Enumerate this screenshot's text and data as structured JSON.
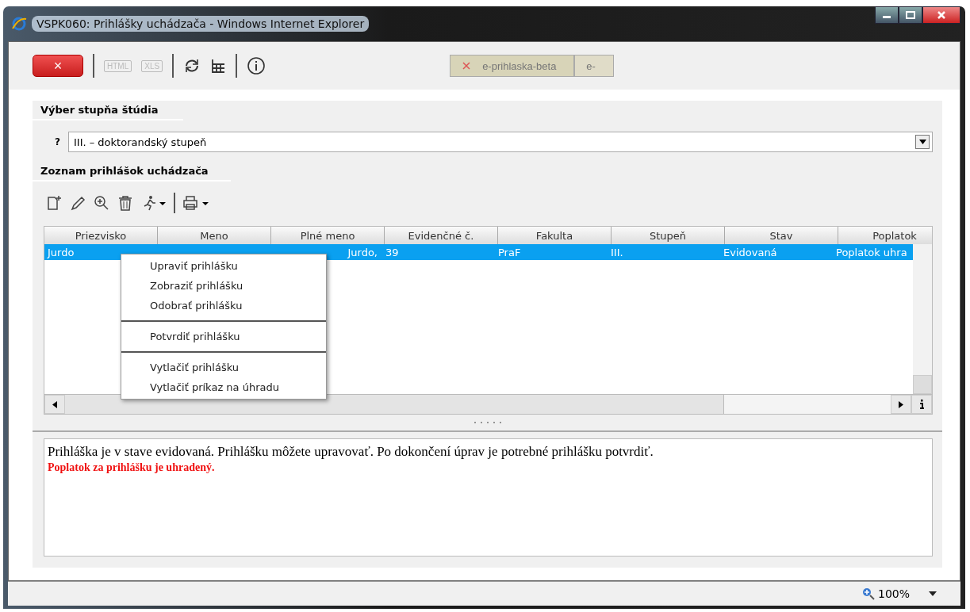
{
  "window": {
    "title": "VSPK060: Prihlášky uchádzača - Windows Internet Explorer"
  },
  "toolbar": {
    "close_label": "×",
    "export_buttons": [
      {
        "label": "HTML",
        "disabled": true
      },
      {
        "label": "XLS",
        "disabled": true
      }
    ],
    "tab_active": "e-prihlaska-beta",
    "tab_other": "e-"
  },
  "study_level": {
    "title": "Výber stupňa štúdia",
    "help": "?",
    "value": "III. – doktorandský stupeň"
  },
  "applications": {
    "title": "Zoznam prihlášok uchádzača",
    "columns": [
      "Priezvisko",
      "Meno",
      "Plné meno",
      "Evidenčné č.",
      "Fakulta",
      "Stupeň",
      "Stav",
      "Poplatok"
    ],
    "rows": [
      {
        "selected": true,
        "cells": [
          "Jurdo",
          null,
          "Jurdo,",
          "39",
          "PraF",
          "III.",
          "Evidovaná",
          "Poplatok uhra"
        ]
      }
    ]
  },
  "context_menu": [
    {
      "kind": "item",
      "label": "Upraviť prihlášku"
    },
    {
      "kind": "item",
      "label": "Zobraziť prihlášku"
    },
    {
      "kind": "item",
      "label": "Odobrať prihlášku"
    },
    {
      "kind": "separator"
    },
    {
      "kind": "item",
      "label": "Potvrdiť prihlášku"
    },
    {
      "kind": "separator"
    },
    {
      "kind": "item",
      "label": "Vytlačiť prihlášku"
    },
    {
      "kind": "item",
      "label": "Vytlačiť príkaz na úhradu"
    }
  ],
  "message": {
    "text": "Prihláška je v stave evidovaná. Prihlášku môžete upravovať. Po dokončení úprav je potrebné prihlášku potvrdiť.",
    "fee_note": "Poplatok za prihlášku je uhradený."
  },
  "status_bar": {
    "zoom": "100%"
  }
}
